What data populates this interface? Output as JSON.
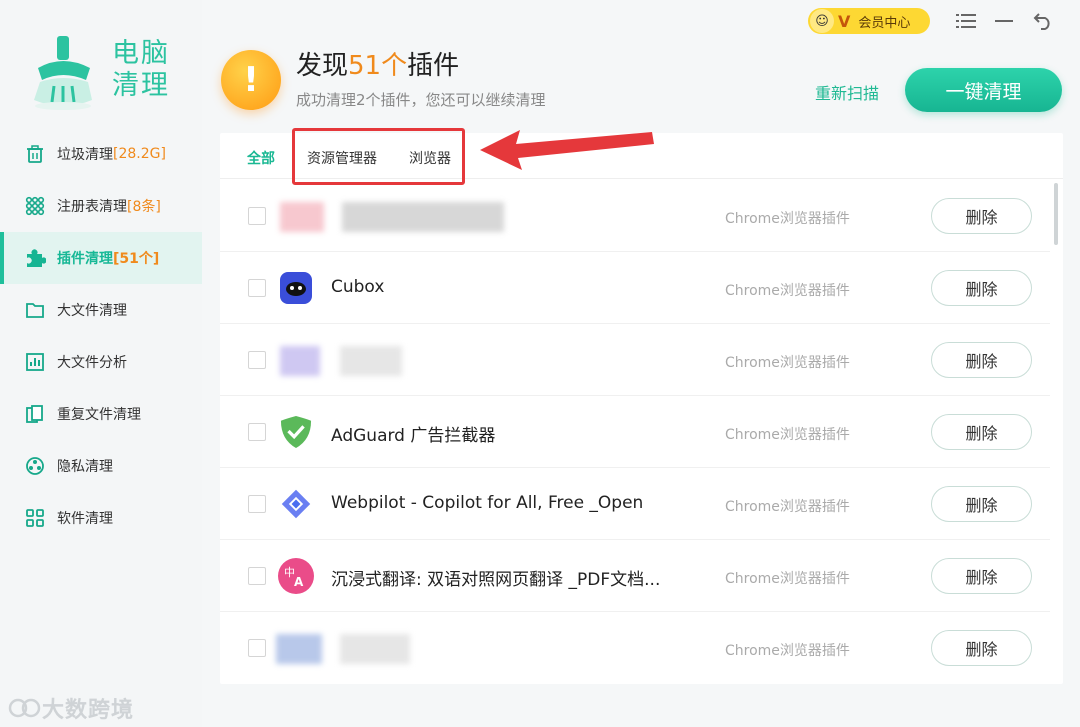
{
  "app": {
    "logo_line1": "电脑",
    "logo_line2": "清理"
  },
  "topbar": {
    "vip_badge": "V",
    "vip_label": "会员中心"
  },
  "sidebar": {
    "items": [
      {
        "label": "垃圾清理",
        "badge": "[28.2G]",
        "icon": "trash-icon"
      },
      {
        "label": "注册表清理",
        "badge": "[8条]",
        "icon": "grid-icon"
      },
      {
        "label": "插件清理",
        "badge": "[51个]",
        "icon": "puzzle-icon"
      },
      {
        "label": "大文件清理",
        "badge": "",
        "icon": "folder-icon"
      },
      {
        "label": "大文件分析",
        "badge": "",
        "icon": "chart-icon"
      },
      {
        "label": "重复文件清理",
        "badge": "",
        "icon": "copy-icon"
      },
      {
        "label": "隐私清理",
        "badge": "",
        "icon": "privacy-icon"
      },
      {
        "label": "软件清理",
        "badge": "",
        "icon": "apps-icon"
      }
    ]
  },
  "header": {
    "title_prefix": "发现",
    "title_count": "51个",
    "title_suffix": "插件",
    "subtitle": "成功清理2个插件，您还可以继续清理",
    "rescan": "重新扫描",
    "clean_all": "一键清理"
  },
  "tabs": [
    "全部",
    "资源管理器",
    "浏览器"
  ],
  "rows": [
    {
      "name": "",
      "type": "Chrome浏览器插件",
      "action": "删除",
      "blurred": true
    },
    {
      "name": "Cubox",
      "type": "Chrome浏览器插件",
      "action": "删除",
      "blurred": false
    },
    {
      "name": "",
      "type": "Chrome浏览器插件",
      "action": "删除",
      "blurred": true
    },
    {
      "name": "AdGuard 广告拦截器",
      "type": "Chrome浏览器插件",
      "action": "删除",
      "blurred": false
    },
    {
      "name": "Webpilot - Copilot for All, Free _Open",
      "type": "Chrome浏览器插件",
      "action": "删除",
      "blurred": false
    },
    {
      "name": "沉浸式翻译: 双语对照网页翻译 _PDF文档...",
      "type": "Chrome浏览器插件",
      "action": "删除",
      "blurred": false
    },
    {
      "name": "",
      "type": "Chrome浏览器插件",
      "action": "删除",
      "blurred": true
    }
  ],
  "watermark": "大数跨境",
  "colors": {
    "accent": "#1fbf9b",
    "warning": "#f08a1c",
    "highlight": "#e5383b"
  }
}
